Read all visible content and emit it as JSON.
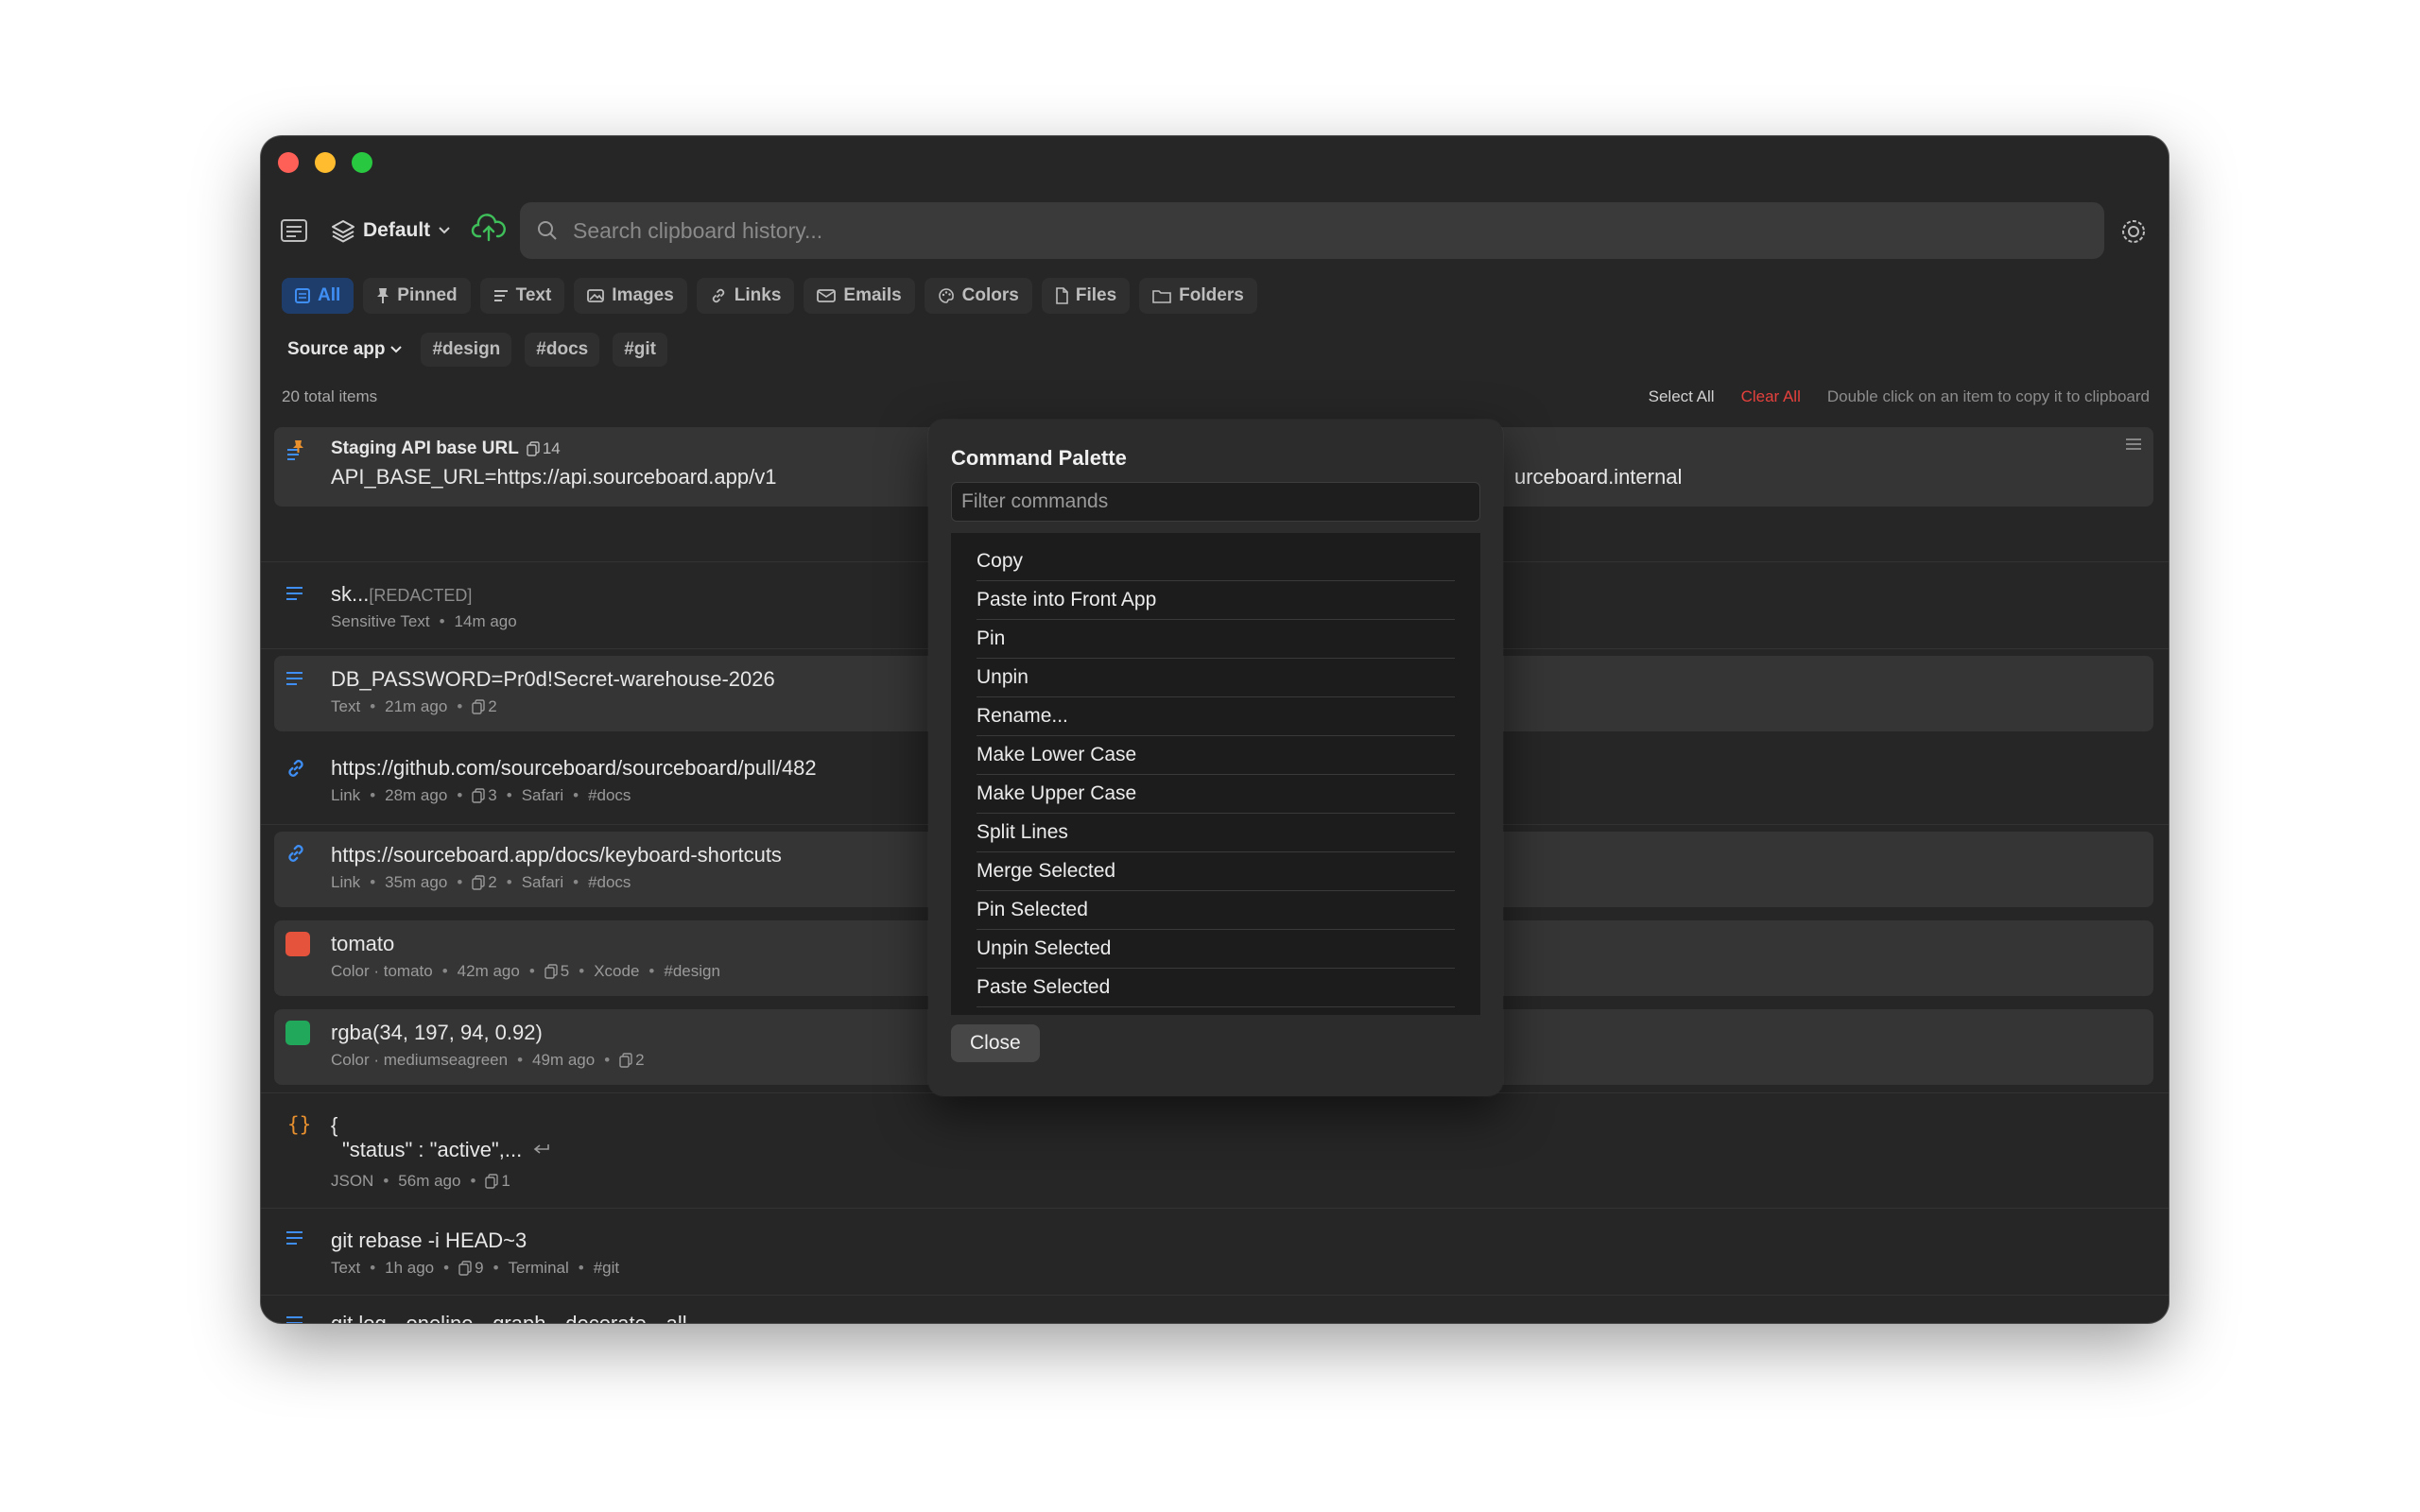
{
  "window": {
    "profile": "Default",
    "search": {
      "placeholder": "Search clipboard history..."
    }
  },
  "tabs": [
    {
      "label": "All",
      "icon": "all-icon",
      "active": true
    },
    {
      "label": "Pinned",
      "icon": "pin-icon"
    },
    {
      "label": "Text",
      "icon": "text-icon"
    },
    {
      "label": "Images",
      "icon": "image-icon"
    },
    {
      "label": "Links",
      "icon": "link-icon"
    },
    {
      "label": "Emails",
      "icon": "email-icon"
    },
    {
      "label": "Colors",
      "icon": "palette-icon"
    },
    {
      "label": "Files",
      "icon": "file-icon"
    },
    {
      "label": "Folders",
      "icon": "folder-icon"
    }
  ],
  "tags": {
    "source_app": "Source app",
    "items": [
      "#design",
      "#docs",
      "#git"
    ]
  },
  "list_header": {
    "count": "20 total items",
    "select_all": "Select All",
    "clear_all": "Clear All",
    "hint": "Double click on an item to copy it to clipboard"
  },
  "items": [
    {
      "title": "Staging API base URL",
      "copies": "14",
      "value": "API_BASE_URL=https://api.sourceboard.app/v1",
      "value_right": "urceboard.internal",
      "pinned": true
    },
    {
      "title": "sk...",
      "redacted": "[REDACTED]",
      "meta": [
        "Sensitive Text",
        "14m ago"
      ]
    },
    {
      "title": "DB_PASSWORD=Pr0d!Secret-warehouse-2026",
      "meta": [
        "Text",
        "21m ago"
      ],
      "copies": "2"
    },
    {
      "title": "https://github.com/sourceboard/sourceboard/pull/482",
      "meta": [
        "Link",
        "28m ago"
      ],
      "copies": "3",
      "extra": [
        "Safari",
        "#docs"
      ]
    },
    {
      "title": "https://sourceboard.app/docs/keyboard-shortcuts",
      "meta": [
        "Link",
        "35m ago"
      ],
      "copies": "2",
      "extra": [
        "Safari",
        "#docs"
      ]
    },
    {
      "title": "tomato",
      "meta": [
        "Color · tomato",
        "42m ago"
      ],
      "copies": "5",
      "extra": [
        "Xcode",
        "#design"
      ],
      "swatch": "#e5533c"
    },
    {
      "title": "rgba(34, 197, 94, 0.92)",
      "meta": [
        "Color · mediumseagreen",
        "49m ago"
      ],
      "copies": "2",
      "swatch": "#22a85a"
    },
    {
      "title": "{",
      "title2": "\"status\" : \"active\",...",
      "meta": [
        "JSON",
        "56m ago"
      ],
      "copies": "1"
    },
    {
      "title": "git rebase -i HEAD~3",
      "meta": [
        "Text",
        "1h ago"
      ],
      "copies": "9",
      "extra": [
        "Terminal",
        "#git"
      ]
    },
    {
      "title": "git log --oneline --graph --decorate --all"
    }
  ],
  "palette": {
    "title": "Command Palette",
    "filter_placeholder": "Filter commands",
    "commands": [
      "Copy",
      "Paste into Front App",
      "Pin",
      "Unpin",
      "Rename...",
      "Make Lower Case",
      "Make Upper Case",
      "Split Lines",
      "Merge Selected",
      "Pin Selected",
      "Unpin Selected",
      "Paste Selected"
    ],
    "close": "Close"
  },
  "colors": {
    "accent": "#3f8ef3",
    "danger": "#e5413d",
    "pin": "#e8902e",
    "cloud": "#3fbf5a"
  }
}
